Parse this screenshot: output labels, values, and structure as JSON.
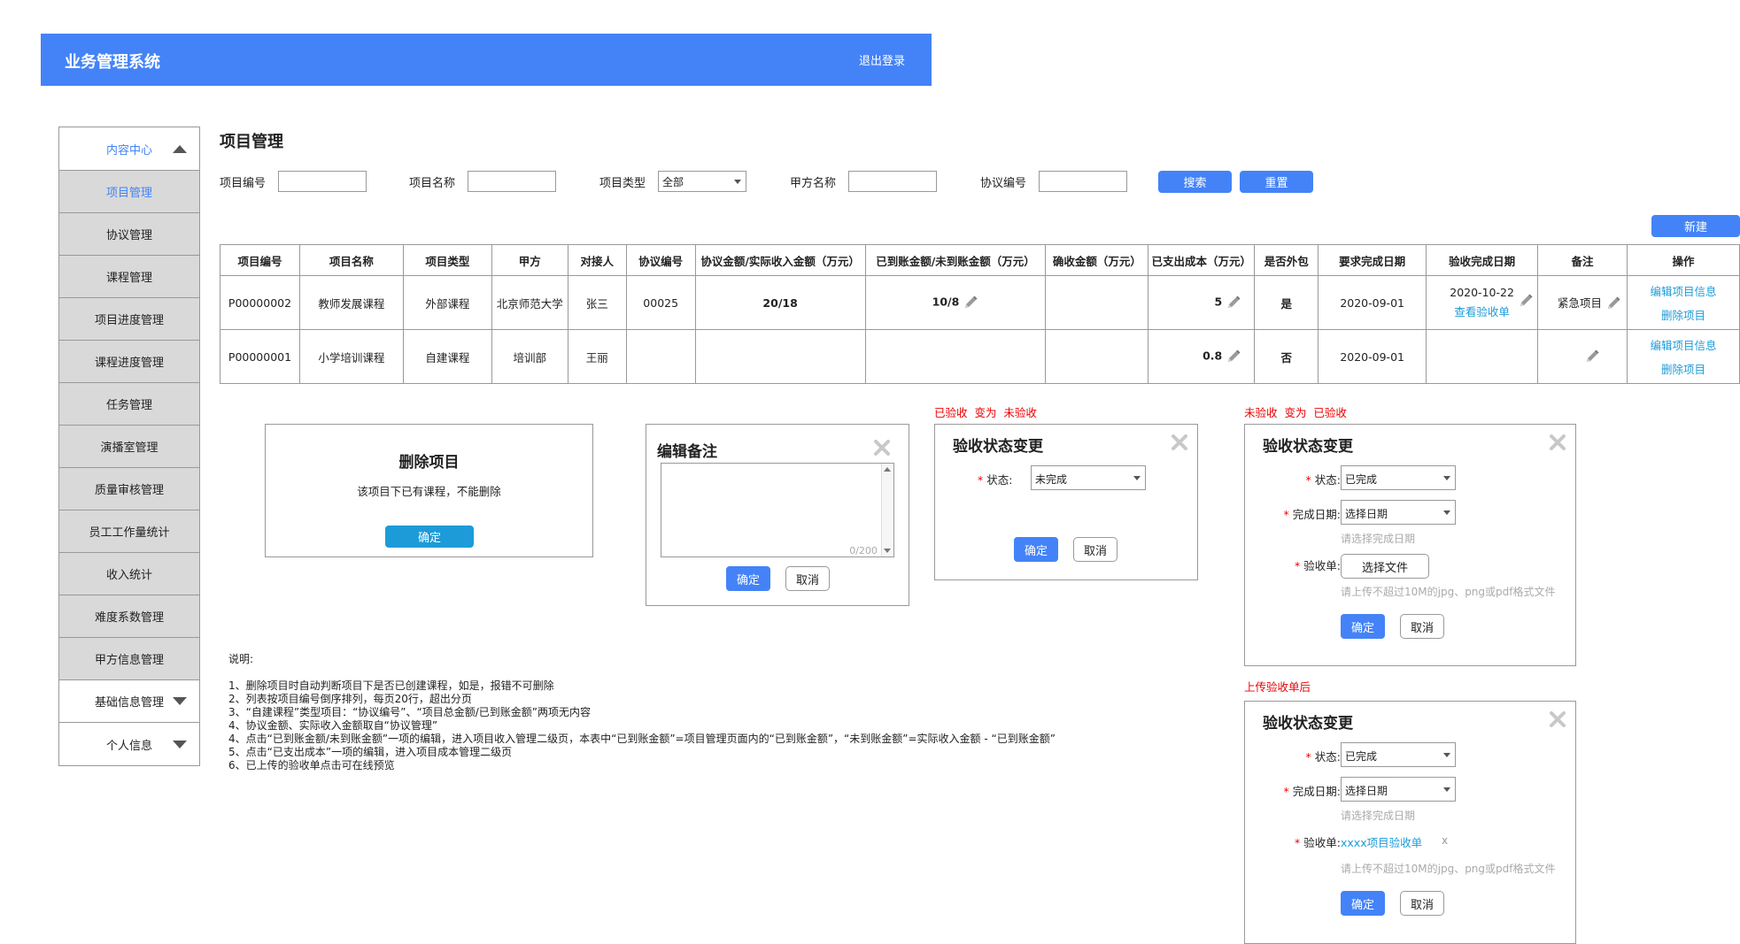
{
  "header": {
    "title": "业务管理系统",
    "logout": "退出登录"
  },
  "sidebar": {
    "head": "内容中心",
    "items": [
      "项目管理",
      "协议管理",
      "课程管理",
      "项目进度管理",
      "课程进度管理",
      "任务管理",
      "演播室管理",
      "质量审核管理",
      "员工工作量统计",
      "收入统计",
      "难度系数管理",
      "甲方信息管理"
    ],
    "groups": [
      "基础信息管理",
      "个人信息"
    ]
  },
  "page": {
    "title": "项目管理"
  },
  "filters": {
    "project_no": "项目编号",
    "project_name": "项目名称",
    "project_type": "项目类型",
    "project_type_value": "全部",
    "party_a": "甲方名称",
    "agreement_no": "协议编号",
    "search": "搜索",
    "reset": "重置",
    "new": "新建"
  },
  "table": {
    "headers": [
      "项目编号",
      "项目名称",
      "项目类型",
      "甲方",
      "对接人",
      "协议编号",
      "协议金额/实际收入金额（万元）",
      "已到账金额/未到账金额（万元）",
      "确收金额（万元）",
      "已支出成本（万元）",
      "是否外包",
      "要求完成日期",
      "验收完成日期",
      "备注",
      "操作"
    ],
    "rows": [
      {
        "no": "P00000002",
        "name": "教师发展课程",
        "type": "外部课程",
        "party": "北京师范大学",
        "contact": "张三",
        "agreement": "00025",
        "amount": "20/18",
        "arrived": "10/8",
        "confirmed": "",
        "cost": "5",
        "outsourced": "是",
        "due": "2020-09-01",
        "accepted": "2020-10-22",
        "view_receipt": "查看验收单",
        "remark": "紧急项目",
        "edit": "编辑项目信息",
        "delete": "删除项目"
      },
      {
        "no": "P00000001",
        "name": "小学培训课程",
        "type": "自建课程",
        "party": "培训部",
        "contact": "王丽",
        "agreement": "",
        "amount": "",
        "arrived": "",
        "confirmed": "",
        "cost": "0.8",
        "outsourced": "否",
        "due": "2020-09-01",
        "accepted": "",
        "view_receipt": "",
        "remark": "",
        "edit": "编辑项目信息",
        "delete": "删除项目"
      }
    ]
  },
  "dialog_delete": {
    "title": "删除项目",
    "message": "该项目下已有课程，不能删除",
    "ok": "确定"
  },
  "dialog_remark": {
    "title": "编辑备注",
    "counter": "0/200",
    "ok": "确定",
    "cancel": "取消"
  },
  "dialog_accept1": {
    "caption": "已验收  变为  未验收",
    "title": "验收状态变更",
    "status_label": "状态:",
    "status_value": "未完成",
    "ok": "确定",
    "cancel": "取消"
  },
  "dialog_accept2": {
    "caption": "未验收  变为  已验收",
    "title": "验收状态变更",
    "status_label": "状态:",
    "status_value": "已完成",
    "date_label": "完成日期:",
    "date_value": "选择日期",
    "date_hint": "请选择完成日期",
    "receipt_label": "验收单:",
    "file_button": "选择文件",
    "file_hint": "请上传不超过10M的jpg、png或pdf格式文件",
    "ok": "确定",
    "cancel": "取消"
  },
  "dialog_accept3": {
    "caption": "上传验收单后",
    "title": "验收状态变更",
    "status_label": "状态:",
    "status_value": "已完成",
    "date_label": "完成日期:",
    "date_value": "选择日期",
    "date_hint": "请选择完成日期",
    "receipt_label": "验收单:",
    "file_name": "xxxx项目验收单",
    "remove": "x",
    "file_hint": "请上传不超过10M的jpg、png或pdf格式文件",
    "ok": "确定",
    "cancel": "取消"
  },
  "notes": {
    "title": "说明:",
    "lines": [
      "1、删除项目时自动判断项目下是否已创建课程，如是，报错不可删除",
      "2、列表按项目编号倒序排列，每页20行，超出分页",
      "3、“自建课程”类型项目：“协议编号”、“项目总金额/已到账金额”两项无内容",
      "4、协议金额、实际收入金额取自“协议管理”",
      "4、点击“已到账金额/未到账金额”一项的编辑，进入项目收入管理二级页，本表中“已到账金额”=项目管理页面内的“已到账金额”，“未到账金额”=实际收入金额 - “已到账金额”",
      "5、点击“已支出成本”一项的编辑，进入项目成本管理二级页",
      "6、已上传的验收单点击可在线预览"
    ]
  }
}
